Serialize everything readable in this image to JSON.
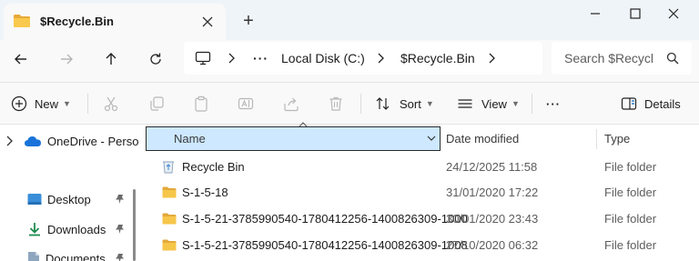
{
  "window": {
    "tab_title": "$Recycle.Bin",
    "new_tab_symbol": "+",
    "controls": [
      "minimize-icon",
      "maximize-icon",
      "close-icon"
    ]
  },
  "address_bar": {
    "breadcrumbs": [
      "Local Disk (C:)",
      "$Recycle.Bin"
    ],
    "more_symbol": "···",
    "search_placeholder": "Search $Recycl"
  },
  "command_bar": {
    "new_label": "New",
    "sort_label": "Sort",
    "view_label": "View",
    "more_symbol": "···",
    "details_label": "Details",
    "disabled_icons": [
      "cut-icon",
      "copy-icon",
      "paste-icon",
      "rename-icon",
      "share-icon",
      "delete-icon"
    ]
  },
  "sidebar": {
    "items": [
      {
        "label": "OneDrive - Perso",
        "icon": "onedrive-icon"
      },
      {
        "label": "Desktop",
        "icon": "desktop-folder-icon",
        "pinned": true
      },
      {
        "label": "Downloads",
        "icon": "downloads-icon",
        "pinned": true
      },
      {
        "label": "Documents",
        "icon": "documents-icon",
        "pinned": true
      }
    ]
  },
  "file_list": {
    "columns": [
      "Name",
      "Date modified",
      "Type"
    ],
    "sort_column": "Name",
    "rows": [
      {
        "name": "Recycle Bin",
        "date": "24/12/2025 11:58",
        "type": "File folder",
        "icon": "recycle-bin-icon"
      },
      {
        "name": "S-1-5-18",
        "date": "31/01/2020 17:22",
        "type": "File folder",
        "icon": "folder-icon"
      },
      {
        "name": "S-1-5-21-3785990540-1780412256-1400826309-1000",
        "date": "30/01/2020 23:43",
        "type": "File folder",
        "icon": "folder-icon"
      },
      {
        "name": "S-1-5-21-3785990540-1780412256-1400826309-1008",
        "date": "27/10/2020 06:32",
        "type": "File folder",
        "icon": "folder-icon"
      }
    ]
  },
  "colors": {
    "titlebar_bg": "#eff4f9",
    "selection_bg": "#cde8ff",
    "folder_yellow": "#f5c342",
    "accent_blue": "#0067c0"
  }
}
